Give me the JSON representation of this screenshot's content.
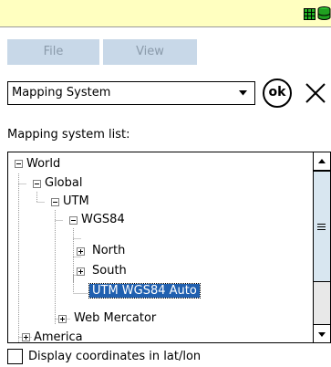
{
  "menu": {
    "file": "File",
    "view": "View"
  },
  "selector": {
    "value": "Mapping System",
    "ok": "ok"
  },
  "list_label": "Mapping system list:",
  "tree": {
    "items": [
      {
        "label": "World",
        "expanded": true
      },
      {
        "label": "Global",
        "expanded": true
      },
      {
        "label": "UTM",
        "expanded": true
      },
      {
        "label": "WGS84",
        "expanded": true
      },
      {
        "label": "North",
        "expanded": false
      },
      {
        "label": "South",
        "expanded": false
      },
      {
        "label": "UTM WGS84 Auto",
        "selected": true
      },
      {
        "label": "Web Mercator",
        "expanded": false
      },
      {
        "label": "America",
        "expanded": false
      }
    ]
  },
  "checkbox": {
    "label": "Display coordinates in lat/lon",
    "checked": false
  },
  "colors": {
    "title_bg": "#ffffc0",
    "menu_bg": "#c8d8e8",
    "selection": "#2060b0",
    "status_icon": "#10a010"
  },
  "icons": [
    "grid-icon",
    "database-icon",
    "dropdown-arrow-icon",
    "close-icon",
    "scroll-up-icon",
    "scroll-down-icon"
  ]
}
